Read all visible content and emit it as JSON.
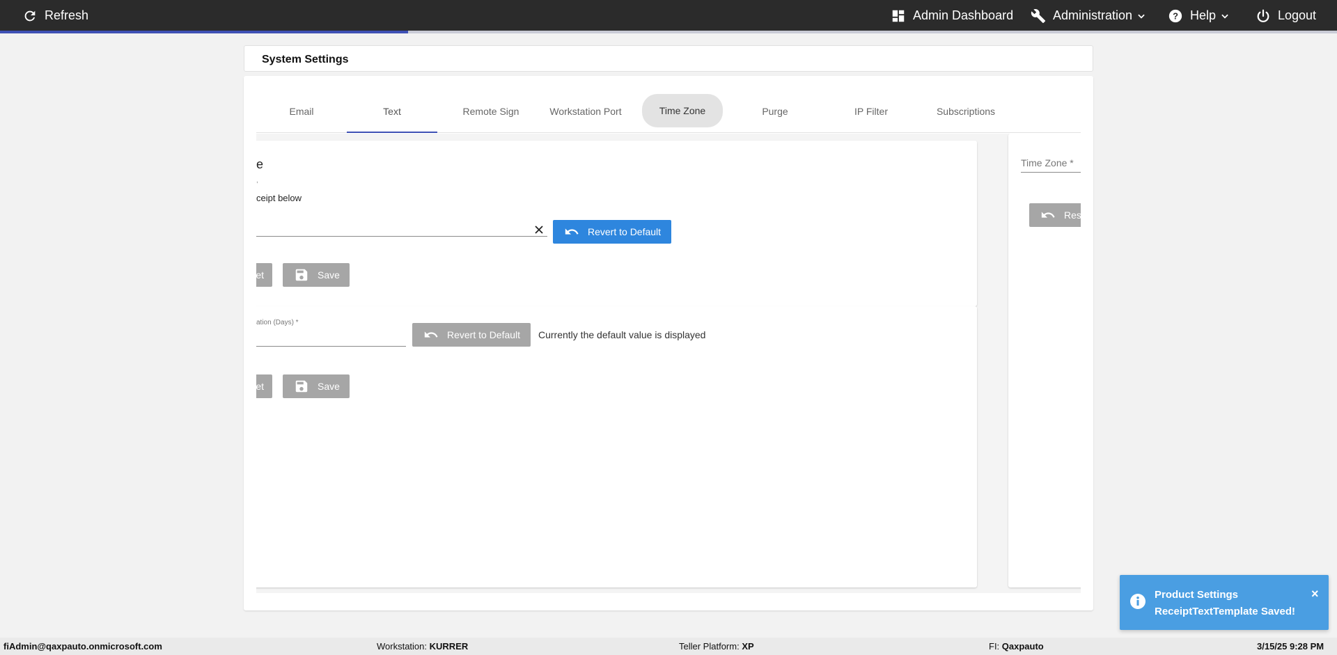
{
  "topbar": {
    "refresh_label": "Refresh",
    "admin_dashboard_label": "Admin Dashboard",
    "administration_label": "Administration",
    "help_label": "Help",
    "logout_label": "Logout",
    "load_progress": 0.305
  },
  "page": {
    "title": "System Settings"
  },
  "tabs": [
    {
      "label": "Email"
    },
    {
      "label": "Text"
    },
    {
      "label": "Remote Sign"
    },
    {
      "label": "Workstation Port"
    },
    {
      "label": "Time Zone"
    },
    {
      "label": "Purge"
    },
    {
      "label": "IP Filter"
    },
    {
      "label": "Subscriptions"
    }
  ],
  "receipt_panel": {
    "heading_fragment": "e",
    "subtext_fragment": ",",
    "text_fragment": "ceipt below",
    "input_value": "",
    "revert_label": "Revert to Default",
    "reset_fragment": "et",
    "save_label": "Save"
  },
  "expiration_panel": {
    "field_label_fragment": "ation (Days) *",
    "input_value": "",
    "revert_label": "Revert to Default",
    "status_text": "Currently the default value is displayed",
    "reset_fragment": "et",
    "save_label": "Save"
  },
  "timezone_panel": {
    "field_label": "Time Zone *",
    "reset_fragment": "Res"
  },
  "toast": {
    "line1": "Product Settings",
    "line2": "ReceiptTextTemplate Saved!",
    "close_glyph": "×"
  },
  "footer": {
    "user": "fiAdmin@qaxpauto.onmicrosoft.com",
    "workstation_label": "Workstation:",
    "workstation_value": "KURRER",
    "platform_label": "Teller Platform:",
    "platform_value": "XP",
    "fi_label": "FI:",
    "fi_value": "Qaxpauto",
    "datetime": "3/15/25 9:28 PM"
  },
  "colors": {
    "topbar_bg": "#2b2b2b",
    "accent": "#3f51b5",
    "primary_button": "#2e86de",
    "disabled_button": "#a6a6a6",
    "toast_bg": "#4a9ee2"
  }
}
